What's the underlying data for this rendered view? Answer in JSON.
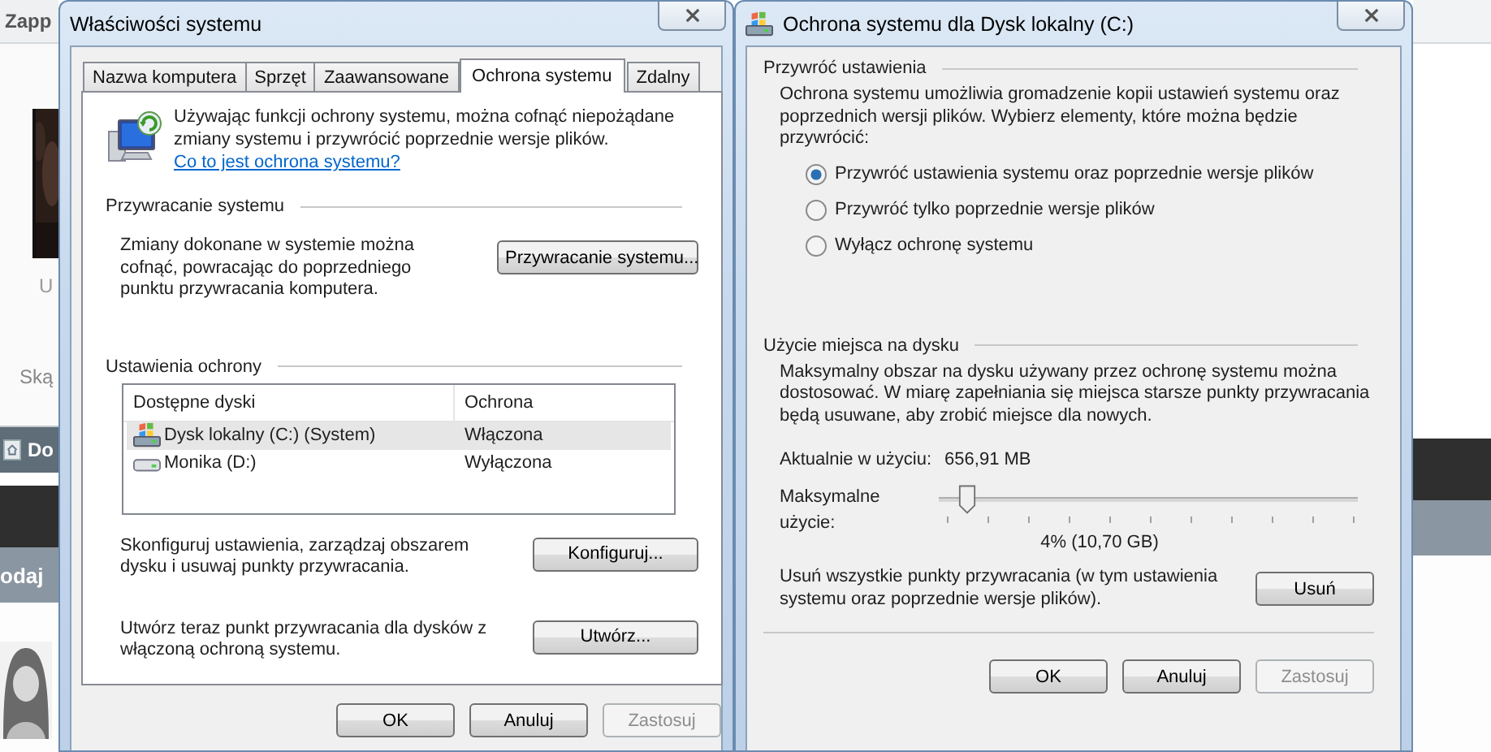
{
  "background_page": {
    "header": "Zapp",
    "label_1": "U",
    "label_2": "Ską",
    "nav_link": "Do",
    "section_bar": "odaj"
  },
  "dialog_1": {
    "title": "Właściwości systemu",
    "tabs": [
      {
        "label": "Nazwa komputera",
        "selected": false
      },
      {
        "label": "Sprzęt",
        "selected": false
      },
      {
        "label": "Zaawansowane",
        "selected": false
      },
      {
        "label": "Ochrona systemu",
        "selected": true
      },
      {
        "label": "Zdalny",
        "selected": false
      }
    ],
    "intro": {
      "text": "Używając funkcji ochrony systemu, można cofnąć niepożądane zmiany systemu i przywrócić poprzednie wersje plików.",
      "link": "Co to jest ochrona systemu?"
    },
    "restore_section": {
      "heading": "Przywracanie systemu",
      "text": "Zmiany dokonane w systemie można cofnąć, powracając do poprzedniego punktu przywracania komputera.",
      "button": "Przywracanie systemu..."
    },
    "protection_section": {
      "heading": "Ustawienia ochrony",
      "table": {
        "columns": [
          "Dostępne dyski",
          "Ochrona"
        ],
        "rows": [
          {
            "kind": "system",
            "drive": "Dysk lokalny (C:) (System)",
            "protection": "Włączona",
            "selected": true
          },
          {
            "kind": "disk",
            "drive": "Monika (D:)",
            "protection": "Wyłączona",
            "selected": false
          }
        ]
      },
      "configure": {
        "text": "Skonfiguruj ustawienia, zarządzaj obszarem dysku i usuwaj punkty przywracania.",
        "button": "Konfiguruj..."
      },
      "create": {
        "text": "Utwórz teraz punkt przywracania dla dysków z włączoną ochroną systemu.",
        "button": "Utwórz..."
      }
    },
    "buttons": [
      {
        "label": "OK",
        "disabled": false
      },
      {
        "label": "Anuluj",
        "disabled": false
      },
      {
        "label": "Zastosuj",
        "disabled": true
      }
    ]
  },
  "dialog_2": {
    "title": "Ochrona systemu dla Dysk lokalny (C:)",
    "restore_settings": {
      "heading": "Przywróć ustawienia",
      "description": "Ochrona systemu umożliwia gromadzenie kopii ustawień systemu oraz poprzednich wersji plików. Wybierz elementy, które można będzie przywrócić:",
      "options": [
        {
          "label": "Przywróć ustawienia systemu oraz poprzednie wersje plików",
          "selected": true
        },
        {
          "label": "Przywróć tylko poprzednie wersje plików",
          "selected": false
        },
        {
          "label": "Wyłącz ochronę systemu",
          "selected": false
        }
      ]
    },
    "disk_usage": {
      "heading": "Użycie miejsca na dysku",
      "description": "Maksymalny obszar na dysku używany przez ochronę systemu można dostosować. W miarę zapełniania się miejsca starsze punkty przywracania będą usuwane, aby zrobić miejsce dla nowych.",
      "current_label": "Aktualnie w użyciu:",
      "current_value": "656,91 MB",
      "max_label": "Maksymalne użycie:",
      "slider": {
        "level": 0.04
      },
      "slider_reading": "4% (10,70 GB)",
      "delete_text": "Usuń wszystkie punkty przywracania (w tym ustawienia systemu oraz poprzednie wersje plików).",
      "delete_button": "Usuń"
    },
    "buttons": [
      {
        "label": "OK",
        "disabled": false
      },
      {
        "label": "Anuluj",
        "disabled": false
      },
      {
        "label": "Zastosuj",
        "disabled": true
      }
    ]
  }
}
